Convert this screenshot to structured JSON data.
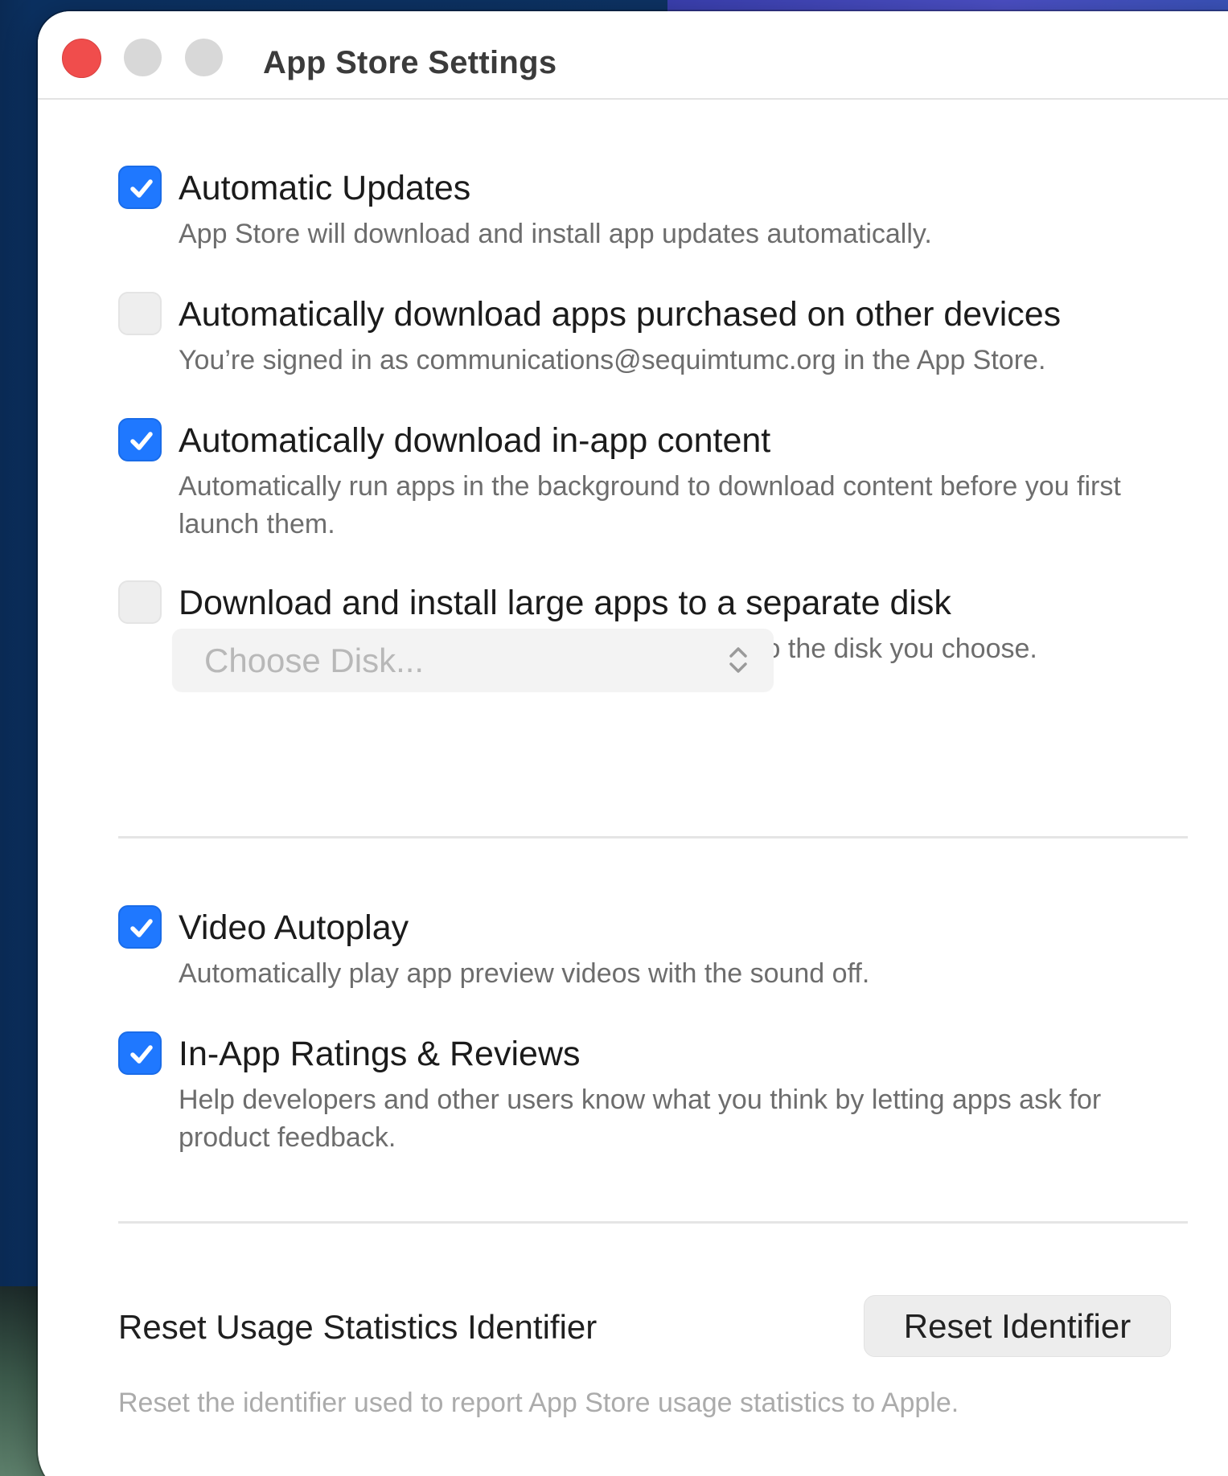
{
  "window": {
    "title": "App Store Settings"
  },
  "settings": [
    {
      "title": "Automatic Updates",
      "description": "App Store will download and install app updates automatically.",
      "checked": true
    },
    {
      "title": "Automatically download apps purchased on other devices",
      "description": "You’re signed in as communications@sequimtumc.org in the App Store.",
      "checked": false
    },
    {
      "title": "Automatically download in-app content",
      "description": "Automatically run apps in the background to download content before you first launch them.",
      "checked": true
    },
    {
      "title": "Download and install large apps to a separate disk",
      "description": "Apps larger than 1 GB will download and install to the disk you choose.",
      "checked": false
    },
    {
      "title": "Video Autoplay",
      "description": "Automatically play app preview videos with the sound off.",
      "checked": true
    },
    {
      "title": "In-App Ratings & Reviews",
      "description": "Help developers and other users know what you think by letting apps ask for product feedback.",
      "checked": true
    }
  ],
  "disk_select": {
    "value": "Choose Disk...",
    "enabled": false
  },
  "reset": {
    "label": "Reset Usage Statistics Identifier",
    "button_label": "Reset Identifier",
    "description": "Reset the identifier used to report App Store usage statistics to Apple."
  },
  "colors": {
    "accent": "#1f78ff",
    "close": "#f04d4c"
  }
}
